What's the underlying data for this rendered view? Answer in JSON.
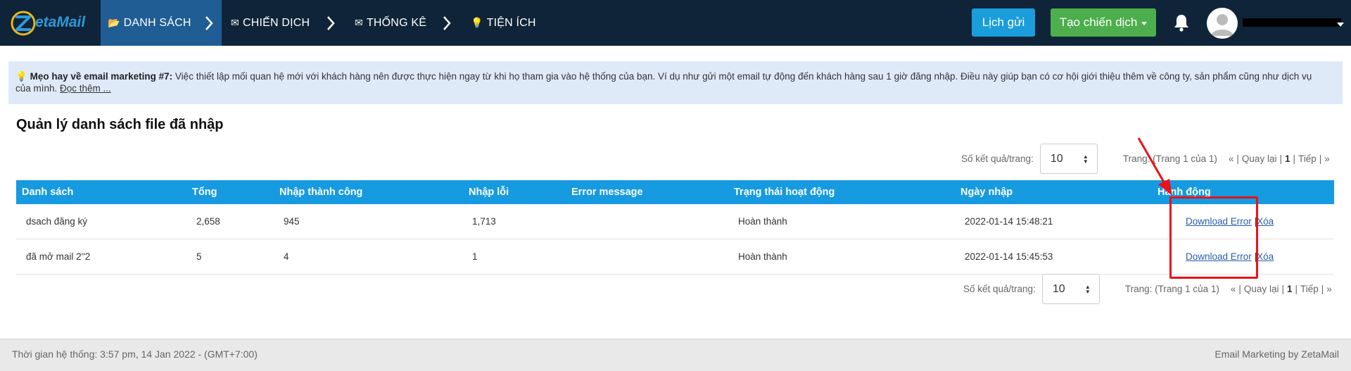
{
  "app": {
    "brand": "ZetaMail"
  },
  "nav": {
    "items": [
      {
        "label": "DANH SÁCH",
        "icon": "folder-icon"
      },
      {
        "label": "CHIẾN DỊCH",
        "icon": "envelope-icon"
      },
      {
        "label": "THỐNG KÊ",
        "icon": "envelope-icon"
      },
      {
        "label": "TIỆN ÍCH",
        "icon": "lightbulb-icon"
      }
    ],
    "schedule_label": "Lịch gửi",
    "create_label": "Tạo chiến dịch"
  },
  "tip": {
    "title": "Mẹo hay về email marketing #7:",
    "text": " Việc thiết lập mối quan hệ mới với khách hàng nên được thực hiện ngay từ khi họ tham gia vào hệ thống của bạn. Ví dụ như gửi một email tự động đến khách hàng sau 1 giờ đăng nhập. Điều này giúp bạn có cơ hội giới thiệu thêm về công ty, sản phẩm cũng như dịch vụ của mình. ",
    "link": "Đọc thêm ..."
  },
  "page": {
    "title": "Quản lý danh sách file đã nhập"
  },
  "pager": {
    "per_page_label": "Số kết quả/trang:",
    "per_page_value": "10",
    "page_info": "Trang: (Trang 1 của 1)",
    "first": "«",
    "prev": "Quay lại",
    "current": "1",
    "next": "Tiếp",
    "last": "»",
    "sep": "|"
  },
  "table": {
    "headers": [
      "Danh sách",
      "Tổng",
      "Nhập thành công",
      "Nhập lỗi",
      "Error message",
      "Trạng thái hoạt động",
      "Ngày nhập",
      "Hành động"
    ],
    "rows": [
      {
        "name": "dsach đăng ký",
        "total": "2,658",
        "success": "945",
        "errors": "1,713",
        "error_message": "",
        "status": "Hoàn thành",
        "date": "2022-01-14 15:48:21",
        "download": "Download Error",
        "sep": "|",
        "delete": "Xóa"
      },
      {
        "name": "đã mở mail 2''2",
        "total": "5",
        "success": "4",
        "errors": "1",
        "error_message": "",
        "status": "Hoàn thành",
        "date": "2022-01-14 15:45:53",
        "download": "Download Error",
        "sep": "|",
        "delete": "Xóa"
      }
    ]
  },
  "footer": {
    "time": "Thời gian hệ thống: 3:57 pm, 14 Jan 2022 - (GMT+7:00)",
    "credit": "Email Marketing by ZetaMail"
  },
  "colors": {
    "nav_bg": "#0f2438",
    "nav_active": "#1f5d94",
    "table_header": "#169ae0",
    "schedule_btn": "#1a9ddb",
    "create_btn": "#4cae4c",
    "annotation": "#e8121c"
  }
}
